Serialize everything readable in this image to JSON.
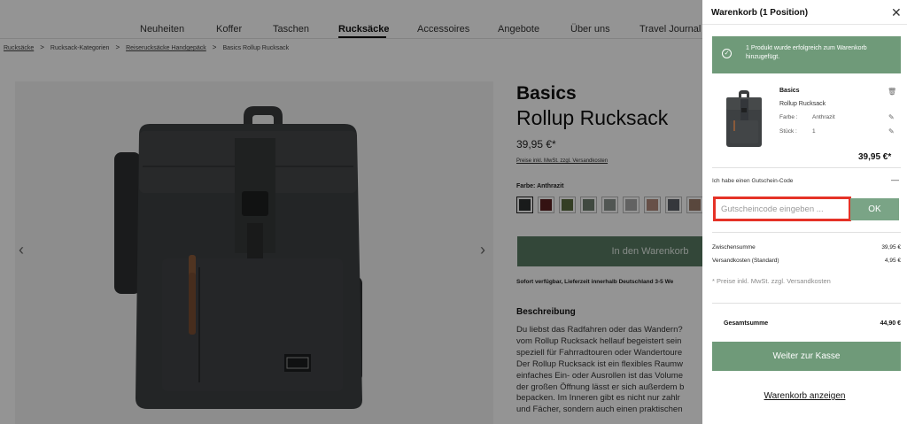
{
  "nav": {
    "items": [
      "Neuheiten",
      "Koffer",
      "Taschen",
      "Rucksäcke",
      "Accessoires",
      "Angebote",
      "Über uns",
      "Travel Journal"
    ],
    "active": "Rucksäcke"
  },
  "breadcrumb": [
    "Rucksäcke",
    "Rucksack-Kategorien",
    "Reiserucksäcke Handgepäck",
    "Basics Rollup Rucksack"
  ],
  "product": {
    "brand": "Basics",
    "name": "Rollup Rucksack",
    "price": "39,95 €*",
    "tax_note": "Preise inkl. MwSt. zzgl. Versandkosten",
    "color_label": "Farbe: Anthrazit",
    "swatch_colors": [
      "#2c2f2f",
      "#5a1f1f",
      "#5b6b3f",
      "#6f7f6f",
      "#8c9490",
      "#a9a9a9",
      "#b28a7c",
      "#5c6068",
      "#9a7b6a",
      "#c0c0c0"
    ],
    "add_to_cart": "In den Warenkorb",
    "availability": "Sofort verfügbar, Lieferzeit innerhalb Deutschland 3-5 We",
    "description_heading": "Beschreibung",
    "description_lines": [
      "Du liebst das Radfahren oder das Wandern?",
      "vom Rollup Rucksack hellauf begeistert sein",
      "speziell für Fahrradtouren oder Wandertoure",
      "Der Rollup Rucksack ist ein flexibles Raumw",
      "einfaches Ein- oder Ausrollen ist das Volume",
      "der großen Öffnung lässt er sich außerdem b",
      "bepacken. Im Inneren gibt es nicht nur zahlr",
      "und Fächer, sondern auch einen praktischen"
    ]
  },
  "cart": {
    "title": "Warenkorb (1 Position)",
    "notice": "1 Produkt wurde erfolgreich zum Warenkorb hinzugefügt.",
    "item": {
      "name_line1": "Basics",
      "name_line2": "Rollup Rucksack",
      "color_label": "Farbe :",
      "color_value": "Anthrazit",
      "qty_label": "Stück :",
      "qty_value": "1",
      "price": "39,95 €*"
    },
    "voucher": {
      "label": "Ich habe einen Gutschein-Code",
      "toggle": "—",
      "placeholder": "Gutscheincode eingeben ...",
      "ok": "OK"
    },
    "subtotal_label": "Zwischensumme",
    "subtotal_value": "39,95 €",
    "shipping_label": "Versandkosten (Standard)",
    "shipping_value": "4,95 €",
    "tax_note": "* Preise inkl. MwSt. zzgl. Versandkosten",
    "total_label": "Gesamtsumme",
    "total_value": "44,90 €",
    "checkout": "Weiter zur Kasse",
    "view_cart": "Warenkorb anzeigen"
  }
}
